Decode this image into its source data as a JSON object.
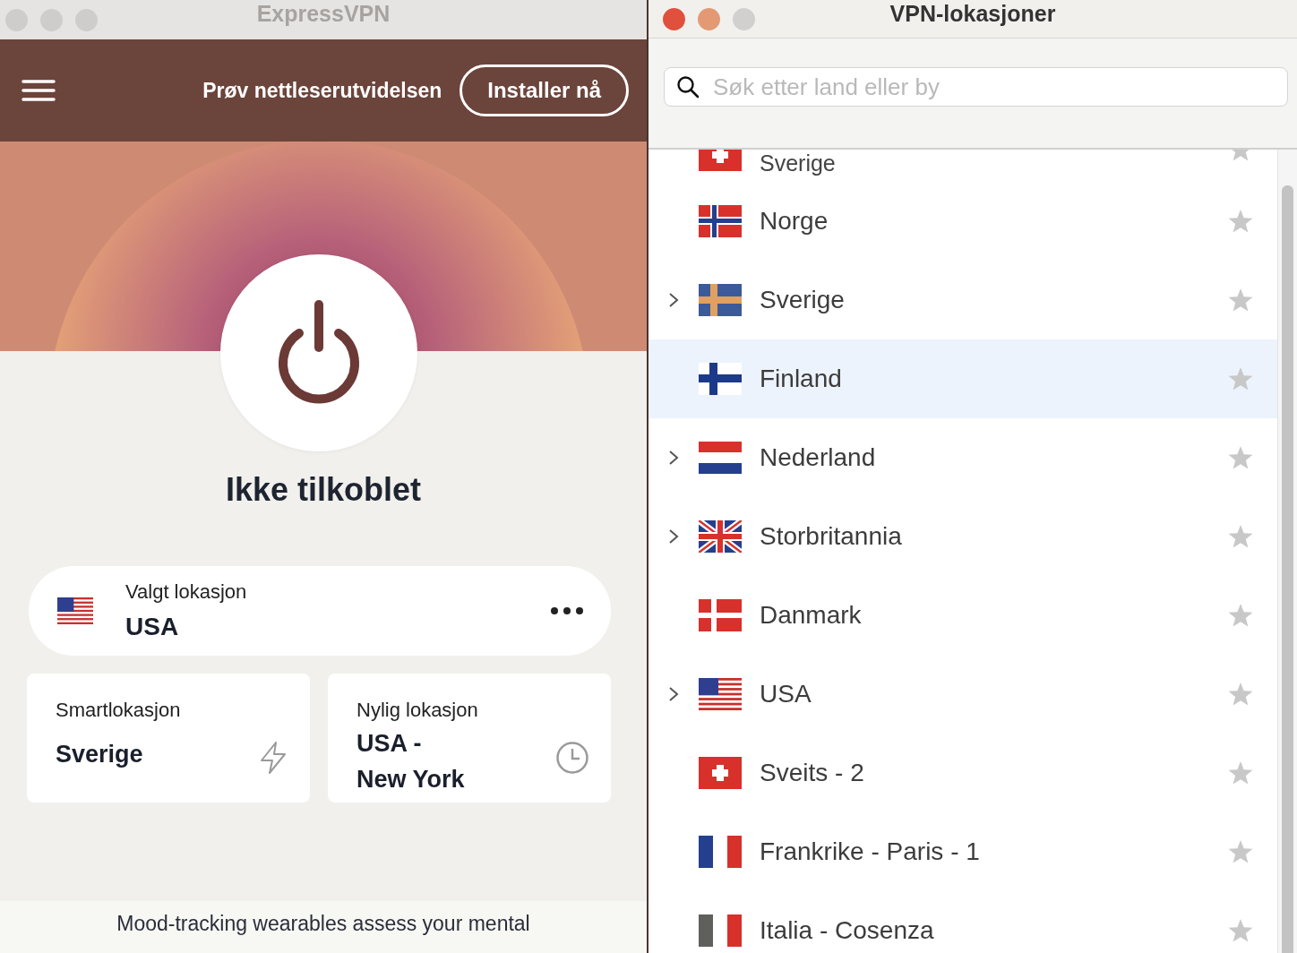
{
  "left_window": {
    "title": "ExpressVPN",
    "banner": {
      "text": "Prøv nettleserutvidelsen",
      "button": "Installer nå"
    },
    "connected": false,
    "status": "Ikke tilkoblet",
    "selected_location": {
      "label": "Valgt lokasjon",
      "value": "USA",
      "kind": "us"
    },
    "shortcuts": [
      {
        "kind": "smart",
        "label": "Smartlokasjon",
        "value": "Sverige"
      },
      {
        "kind": "recent",
        "label": "Nylig lokasjon",
        "value": "USA - New York"
      }
    ],
    "news": "Mood-tracking wearables assess your mental"
  },
  "right_window": {
    "title": "VPN-lokasjoner",
    "search": {
      "placeholder": "Søk etter land eller by"
    },
    "locations": [
      {
        "name": "Sverige",
        "kind": "ch",
        "clipped": true,
        "expandable": false,
        "selected": false
      },
      {
        "name": "Norge",
        "kind": "no",
        "clipped": false,
        "expandable": false,
        "selected": false
      },
      {
        "name": "Sverige",
        "kind": "se",
        "clipped": false,
        "expandable": true,
        "selected": false
      },
      {
        "name": "Finland",
        "kind": "fi",
        "clipped": false,
        "expandable": false,
        "selected": true
      },
      {
        "name": "Nederland",
        "kind": "nl",
        "clipped": false,
        "expandable": true,
        "selected": false
      },
      {
        "name": "Storbritannia",
        "kind": "gb",
        "clipped": false,
        "expandable": true,
        "selected": false
      },
      {
        "name": "Danmark",
        "kind": "dk",
        "clipped": false,
        "expandable": false,
        "selected": false
      },
      {
        "name": "USA",
        "kind": "us",
        "clipped": false,
        "expandable": true,
        "selected": false
      },
      {
        "name": "Sveits - 2",
        "kind": "ch",
        "clipped": false,
        "expandable": false,
        "selected": false
      },
      {
        "name": "Frankrike - Paris - 1",
        "kind": "fr",
        "clipped": false,
        "expandable": false,
        "selected": false
      },
      {
        "name": "Italia - Cosenza",
        "kind": "it",
        "clipped": false,
        "expandable": false,
        "selected": false
      }
    ]
  }
}
